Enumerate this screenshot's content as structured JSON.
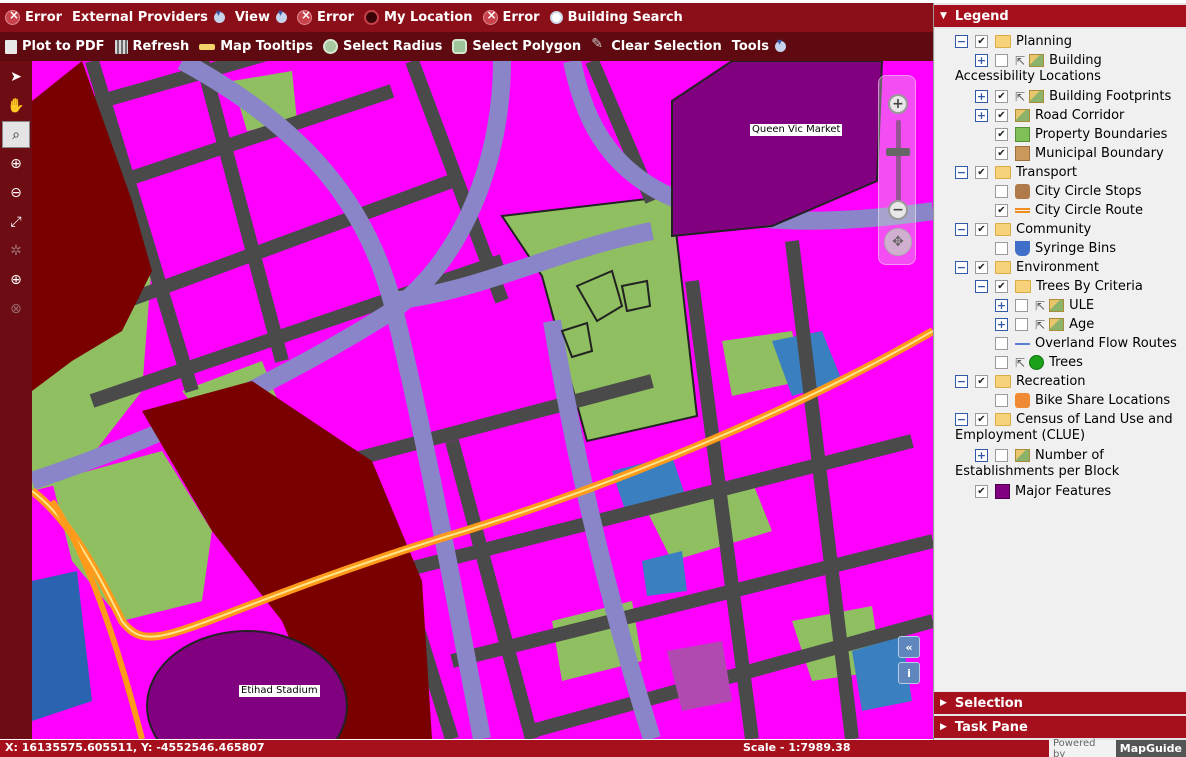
{
  "toolbar1": {
    "items": [
      {
        "label": "Error",
        "icon": "error-icon"
      },
      {
        "label": "External Providers",
        "icon": "",
        "dropdown": true
      },
      {
        "label": "View",
        "icon": "",
        "dropdown": true
      },
      {
        "label": "Error",
        "icon": "error-icon"
      },
      {
        "label": "My Location",
        "icon": "location-icon"
      },
      {
        "label": "Error",
        "icon": "error-icon"
      },
      {
        "label": "Building Search",
        "icon": "search-icon"
      }
    ]
  },
  "toolbar2": {
    "items": [
      {
        "label": "Plot to PDF",
        "icon": "pdf-icon"
      },
      {
        "label": "Refresh",
        "icon": "refresh-icon"
      },
      {
        "label": "Map Tooltips",
        "icon": "tooltip-icon"
      },
      {
        "label": "Select Radius",
        "icon": "select-radius-icon"
      },
      {
        "label": "Select Polygon",
        "icon": "select-polygon-icon"
      },
      {
        "label": "Clear Selection",
        "icon": "clear-selection-icon"
      },
      {
        "label": "Tools",
        "icon": "",
        "dropdown": true
      }
    ]
  },
  "vertical_tools": [
    "select-arrow-icon",
    "pan-hand-icon",
    "zoom-rectangle-icon",
    "zoom-in-icon",
    "zoom-out-icon",
    "zoom-extents-icon",
    "previous-view-icon",
    "next-view-icon",
    "measure-icon"
  ],
  "map": {
    "labels": {
      "market": "Queen Vic Market",
      "stadium": "Etihad Stadium"
    },
    "colors": {
      "background_roads": "#4a4a4a",
      "buildings": "#ff00ff",
      "parks": "#8fbf60",
      "main_roads": "#8a85c8",
      "railway": "#7a0000",
      "major_features": "#800080",
      "route": "#ff9a1a",
      "water": "#2a63b0"
    }
  },
  "legend": {
    "title": "Legend",
    "rows": [
      {
        "label": "Planning"
      },
      {
        "label": "Building"
      },
      {
        "label": "Accessibility Locations"
      },
      {
        "label": "Building Footprints"
      },
      {
        "label": "Road Corridor"
      },
      {
        "label": "Property Boundaries"
      },
      {
        "label": "Municipal Boundary"
      },
      {
        "label": "Transport"
      },
      {
        "label": "City Circle Stops"
      },
      {
        "label": "City Circle Route"
      },
      {
        "label": "Community"
      },
      {
        "label": "Syringe Bins"
      },
      {
        "label": "Environment"
      },
      {
        "label": "Trees By Criteria"
      },
      {
        "label": "ULE"
      },
      {
        "label": "Age"
      },
      {
        "label": "Overland Flow Routes"
      },
      {
        "label": "Trees"
      },
      {
        "label": "Recreation"
      },
      {
        "label": "Bike Share Locations"
      },
      {
        "label": "Census of Land Use and"
      },
      {
        "label": "Employment (CLUE)"
      },
      {
        "label": "Number of"
      },
      {
        "label": "Establishments per Block"
      },
      {
        "label": "Major Features"
      }
    ],
    "colors": {
      "property_boundaries": "#7fbf58",
      "municipal_boundary": "#c9985a",
      "city_circle_route": "#f28c1e",
      "overland_flow": "#5c7fd6",
      "trees": "#1aa31a",
      "major_features": "#800080"
    }
  },
  "selection": {
    "title": "Selection"
  },
  "task_pane": {
    "title": "Task Pane"
  },
  "status": {
    "coords": "X: 16135575.605511, Y: -4552546.465807",
    "scale": "Scale - 1:7989.38",
    "powered_by": "Powered by",
    "brand": "MapGuide"
  }
}
